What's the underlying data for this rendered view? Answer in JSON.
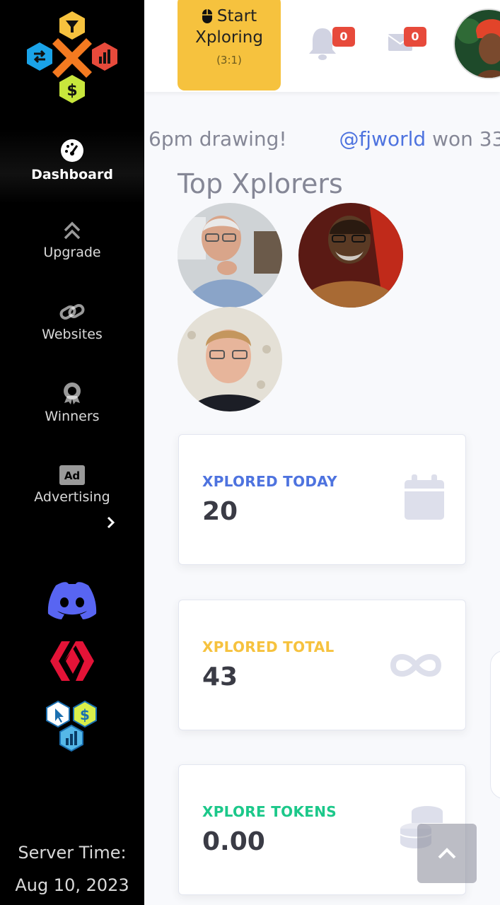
{
  "sidebar": {
    "logo_icon": "xplorer-logo-icon",
    "items": [
      {
        "label": "Dashboard",
        "icon": "speedometer-icon",
        "active": true
      },
      {
        "label": "Upgrade",
        "icon": "double-chevron-up-icon"
      },
      {
        "label": "Websites",
        "icon": "link-icon"
      },
      {
        "label": "Winners",
        "icon": "award-icon"
      },
      {
        "label": "Advertising",
        "icon": "ad-icon"
      }
    ],
    "social": [
      "discord-icon",
      "hive-icon",
      "hexagon-app-icon"
    ],
    "server_time_label": "Server Time:",
    "server_time_value": "Aug 10, 2023"
  },
  "topbar": {
    "start_line1": "Start",
    "start_line2": "Xploring",
    "start_ratio": "(3:1)",
    "notifications_count": "0",
    "messages_count": "0"
  },
  "main": {
    "ticker_before": "6pm drawing!",
    "ticker_user": "@fjworld",
    "ticker_after": "won 33",
    "top_title": "Top Xplorers"
  },
  "cards": [
    {
      "title": "XPLORED TODAY",
      "value": "20",
      "color": "#4e73df",
      "icon": "calendar-icon"
    },
    {
      "title": "XPLORED TOTAL",
      "value": "43",
      "color": "#f6c23e",
      "icon": "infinity-icon"
    },
    {
      "title": "XPLORE TOKENS",
      "value": "0.00",
      "color": "#1cc88a",
      "icon": "coins-icon"
    }
  ],
  "colors": {
    "primary": "#4e73df",
    "warning": "#f6c23e",
    "success": "#1cc88a",
    "danger": "#e74a3b",
    "sidebar": "#000000"
  }
}
